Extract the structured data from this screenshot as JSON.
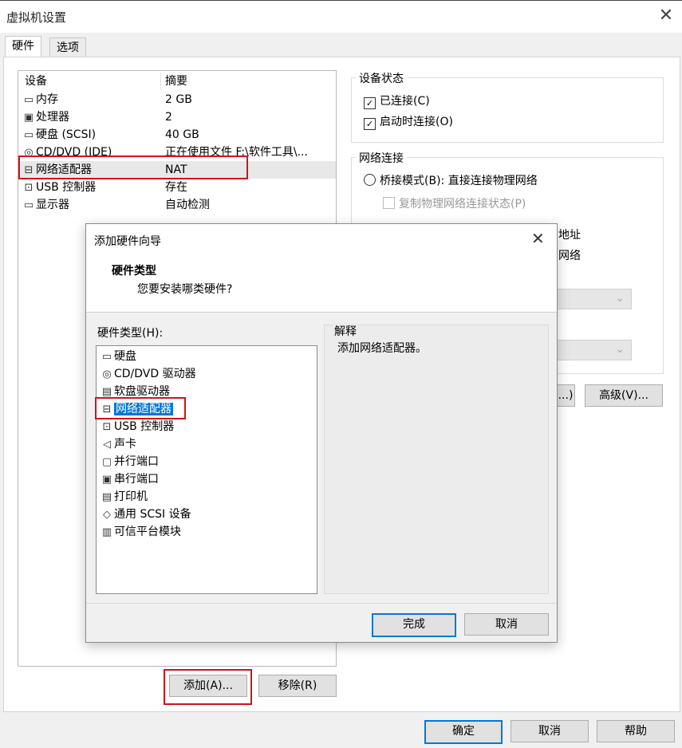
{
  "window": {
    "title": "虚拟机设置",
    "close_icon": "close-icon"
  },
  "tabs": [
    {
      "label": "硬件"
    },
    {
      "label": "选项"
    }
  ],
  "device_list": {
    "headers": {
      "device": "设备",
      "summary": "摘要"
    },
    "rows": [
      {
        "icon": "memory-icon",
        "glyph": "▭",
        "name": "内存",
        "summary": "2 GB"
      },
      {
        "icon": "processor-icon",
        "glyph": "▣",
        "name": "处理器",
        "summary": "2"
      },
      {
        "icon": "harddisk-icon",
        "glyph": "▭",
        "name": "硬盘 (SCSI)",
        "summary": "40 GB"
      },
      {
        "icon": "cd-icon",
        "glyph": "◎",
        "name": "CD/DVD (IDE)",
        "summary": "正在使用文件 F:\\软件工具\\..."
      },
      {
        "icon": "network-icon",
        "glyph": "⊟",
        "name": "网络适配器",
        "summary": "NAT"
      },
      {
        "icon": "usb-icon",
        "glyph": "⊡",
        "name": "USB 控制器",
        "summary": "存在"
      },
      {
        "icon": "display-icon",
        "glyph": "▭",
        "name": "显示器",
        "summary": "自动检测"
      }
    ]
  },
  "buttons": {
    "add": "添加(A)...",
    "remove": "移除(R)",
    "ok": "确定",
    "cancel": "取消",
    "help": "帮助",
    "advanced": "高级(V)...",
    "partial": "...)"
  },
  "device_status": {
    "label": "设备状态",
    "connected": "已连接(C)",
    "connect_on_start": "启动时连接(O)"
  },
  "network": {
    "label": "网络连接",
    "bridged": "桥接模式(B): 直接连接物理网络",
    "replicate": "复制物理网络连接状态(P)",
    "partial_1": "地址",
    "partial_2": "网络"
  },
  "dialog": {
    "title": "添加硬件向导",
    "heading": "硬件类型",
    "subheading": "您要安装哪类硬件?",
    "hw_label": "硬件类型(H):",
    "explain_label": "解释",
    "explain_text": "添加网络适配器。",
    "finish": "完成",
    "cancel": "取消",
    "items": [
      {
        "icon": "harddisk-icon",
        "glyph": "▭",
        "label": "硬盘"
      },
      {
        "icon": "cd-drive-icon",
        "glyph": "◎",
        "label": "CD/DVD 驱动器"
      },
      {
        "icon": "floppy-icon",
        "glyph": "▤",
        "label": "软盘驱动器"
      },
      {
        "icon": "network-icon",
        "glyph": "⊟",
        "label": "网络适配器"
      },
      {
        "icon": "usb-icon",
        "glyph": "⊡",
        "label": "USB 控制器"
      },
      {
        "icon": "speaker-icon",
        "glyph": "◁",
        "label": "声卡"
      },
      {
        "icon": "parallel-port-icon",
        "glyph": "▢",
        "label": "并行端口"
      },
      {
        "icon": "serial-port-icon",
        "glyph": "▣",
        "label": "串行端口"
      },
      {
        "icon": "printer-icon",
        "glyph": "▤",
        "label": "打印机"
      },
      {
        "icon": "scsi-icon",
        "glyph": "◇",
        "label": "通用 SCSI 设备"
      },
      {
        "icon": "tpm-icon",
        "glyph": "▥",
        "label": "可信平台模块"
      }
    ]
  },
  "colors": {
    "accent": "#0078d7",
    "highlight": "#d0121b",
    "selection": "#0078d7"
  }
}
